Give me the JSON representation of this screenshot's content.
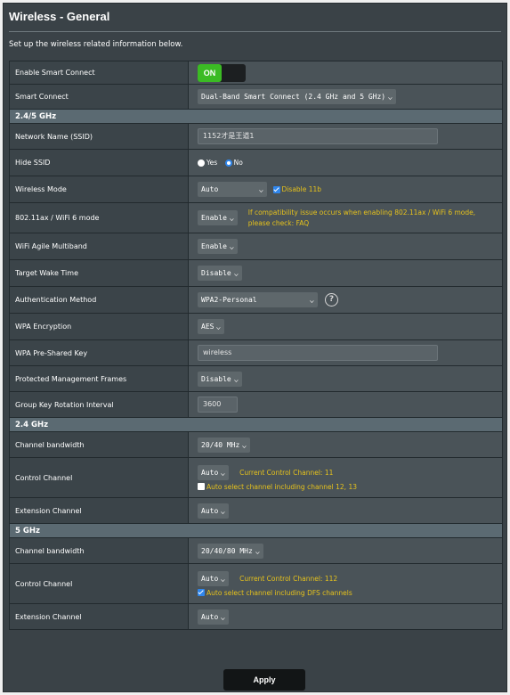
{
  "page": {
    "title": "Wireless - General",
    "description": "Set up the wireless related information below."
  },
  "smart_connect": {
    "enable_label": "Enable Smart Connect",
    "toggle_text": "ON",
    "label": "Smart Connect",
    "value": "Dual-Band Smart Connect (2.4 GHz and 5 GHz)"
  },
  "band_2_4_5": {
    "header": "2.4/5 GHz",
    "ssid_label": "Network Name (SSID)",
    "ssid_value": "1152才是王道1",
    "hide_ssid_label": "Hide SSID",
    "hide_ssid_yes": "Yes",
    "hide_ssid_no": "No",
    "wireless_mode_label": "Wireless Mode",
    "wireless_mode_value": "Auto",
    "disable_11b": "Disable 11b",
    "wifi6_label": "802.11ax / WiFi 6 mode",
    "wifi6_value": "Enable",
    "wifi6_hint": "If compatibility issue occurs when enabling 802.11ax / WiFi 6 mode, please check: FAQ",
    "agile_label": "WiFi Agile Multiband",
    "agile_value": "Enable",
    "twt_label": "Target Wake Time",
    "twt_value": "Disable",
    "auth_label": "Authentication Method",
    "auth_value": "WPA2-Personal",
    "help_glyph": "?",
    "enc_label": "WPA Encryption",
    "enc_value": "AES",
    "psk_label": "WPA Pre-Shared Key",
    "psk_value": "wireless",
    "pmf_label": "Protected Management Frames",
    "pmf_value": "Disable",
    "gkri_label": "Group Key Rotation Interval",
    "gkri_value": "3600"
  },
  "band_2_4": {
    "header": "2.4 GHz",
    "bw_label": "Channel bandwidth",
    "bw_value": "20/40 MHz",
    "cc_label": "Control Channel",
    "cc_value": "Auto",
    "cc_current": "Current Control Channel: 11",
    "cc_auto_check": "Auto select channel including channel 12, 13",
    "ext_label": "Extension Channel",
    "ext_value": "Auto"
  },
  "band_5": {
    "header": "5 GHz",
    "bw_label": "Channel bandwidth",
    "bw_value": "20/40/80 MHz",
    "cc_label": "Control Channel",
    "cc_value": "Auto",
    "cc_current": "Current Control Channel: 112",
    "cc_auto_check": "Auto select channel including DFS channels",
    "ext_label": "Extension Channel",
    "ext_value": "Auto"
  },
  "apply_label": "Apply",
  "colors": {
    "panel_bg": "#3a4247",
    "value_bg": "#4a5358",
    "section_header_bg": "#5b6a72",
    "hint_yellow": "#e6c21c",
    "toggle_green": "#3bbb24",
    "checkbox_blue": "#2f86ec"
  },
  "icons": {
    "dropdown": "chevron-down-icon",
    "help": "question-circle-icon",
    "checkbox": "checkbox-icon",
    "radio": "radio-icon"
  }
}
